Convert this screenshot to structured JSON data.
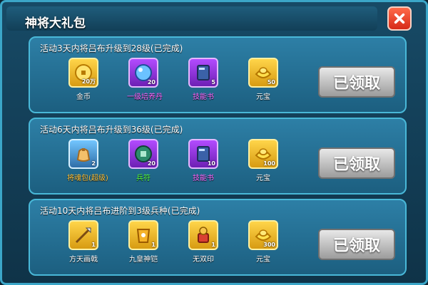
{
  "window": {
    "title": "神将大礼包",
    "close_label": "X"
  },
  "panels": [
    {
      "title": "活动3天内将吕布升级到28级(已完成)",
      "claim_label": "已领取",
      "rewards": [
        {
          "name": "金币",
          "count": "20万",
          "icon": "gold-coin-icon",
          "rarity": "gold"
        },
        {
          "name": "一级培养丹",
          "count": "20",
          "icon": "blue-orb-icon",
          "rarity": "purple"
        },
        {
          "name": "技能书",
          "count": "5",
          "icon": "skill-book-icon",
          "rarity": "purple"
        },
        {
          "name": "元宝",
          "count": "50",
          "icon": "yuanbao-icon",
          "rarity": "gold"
        }
      ]
    },
    {
      "title": "活动6天内将吕布升级到36级(已完成)",
      "claim_label": "已领取",
      "rewards": [
        {
          "name": "将魂包(超级)",
          "count": "2",
          "icon": "soul-bag-icon",
          "rarity": "orange"
        },
        {
          "name": "兵符",
          "count": "20",
          "icon": "military-token-icon",
          "rarity": "purple"
        },
        {
          "name": "技能书",
          "count": "10",
          "icon": "skill-book-icon",
          "rarity": "purple"
        },
        {
          "name": "元宝",
          "count": "100",
          "icon": "yuanbao-icon",
          "rarity": "gold"
        }
      ]
    },
    {
      "title": "活动10天内将吕布进阶到3级兵种(已完成)",
      "claim_label": "已领取",
      "rewards": [
        {
          "name": "方天画戟",
          "count": "1",
          "icon": "halberd-icon",
          "rarity": "gold"
        },
        {
          "name": "九皇神铠",
          "count": "1",
          "icon": "armor-icon",
          "rarity": "gold"
        },
        {
          "name": "无双印",
          "count": "1",
          "icon": "seal-icon",
          "rarity": "gold"
        },
        {
          "name": "元宝",
          "count": "300",
          "icon": "yuanbao-icon",
          "rarity": "gold"
        }
      ]
    }
  ]
}
